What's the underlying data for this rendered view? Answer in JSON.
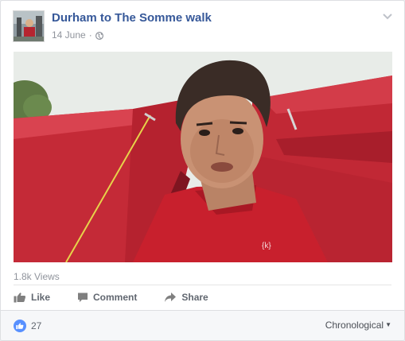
{
  "post": {
    "page_name": "Durham to The Somme walk",
    "date": "14 June",
    "separator": "·",
    "privacy_icon": "globe-icon",
    "options_icon": "chevron-down-icon"
  },
  "video": {
    "content": "man-in-red-tent-selfie"
  },
  "stats": {
    "views": "1.8k Views"
  },
  "actions": {
    "like_label": "Like",
    "comment_label": "Comment",
    "share_label": "Share"
  },
  "footer": {
    "reaction_count": "27",
    "order_label": "Chronological",
    "reaction_icon": "thumbs-up-icon"
  },
  "colors": {
    "link_blue": "#365899",
    "meta_gray": "#90949c",
    "like_blue": "#5890ff",
    "tent_red": "#c62a36"
  }
}
